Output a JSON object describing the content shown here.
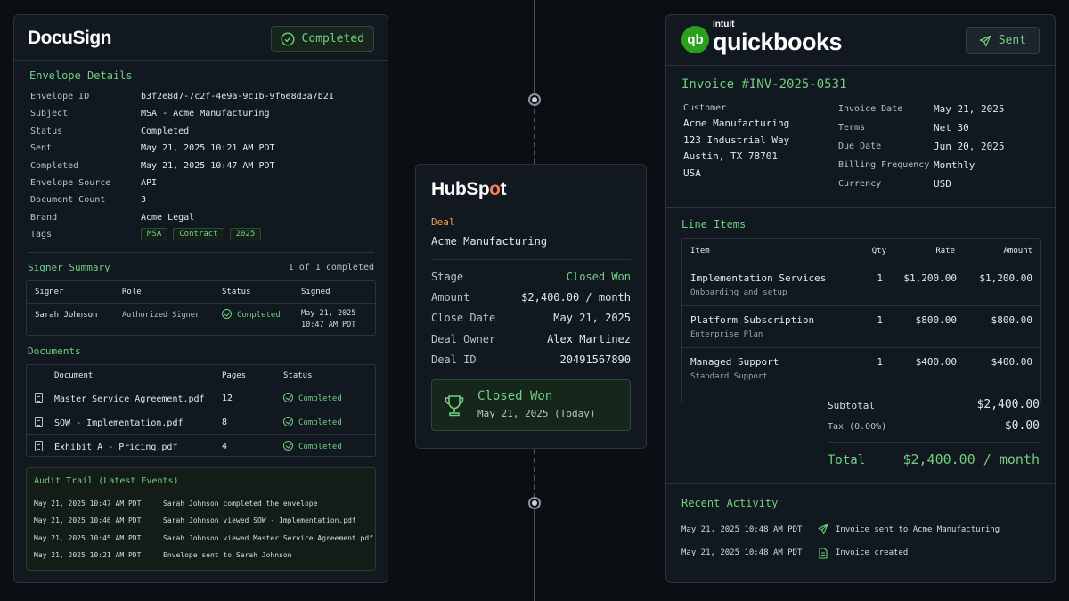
{
  "docusign": {
    "logo": "DocuSign",
    "badge": "Completed",
    "envelope_title": "Envelope Details",
    "details": [
      {
        "k": "Envelope ID",
        "v": "b3f2e8d7-7c2f-4e9a-9c1b-9f6e8d3a7b21"
      },
      {
        "k": "Subject",
        "v": "MSA - Acme Manufacturing"
      },
      {
        "k": "Status",
        "v": "Completed"
      },
      {
        "k": "Sent",
        "v": "May 21, 2025 10:21 AM PDT"
      },
      {
        "k": "Completed",
        "v": "May 21, 2025 10:47 AM PDT"
      },
      {
        "k": "Envelope Source",
        "v": "API"
      },
      {
        "k": "Document Count",
        "v": "3"
      },
      {
        "k": "Brand",
        "v": "Acme Legal"
      }
    ],
    "tags_label": "Tags",
    "tags": [
      "MSA",
      "Contract",
      "2025"
    ],
    "signer_title": "Signer Summary",
    "signer_count": "1 of 1 completed",
    "signer_headers": [
      "Signer",
      "Role",
      "Status",
      "Signed"
    ],
    "signer": {
      "name": "Sarah Johnson",
      "role": "Authorized Signer",
      "status": "Completed",
      "signed_1": "May 21, 2025",
      "signed_2": "10:47 AM PDT"
    },
    "documents_title": "Documents",
    "doc_headers": [
      "Document",
      "Pages",
      "Status"
    ],
    "documents": [
      {
        "name": "Master Service Agreement.pdf",
        "pages": "12",
        "status": "Completed"
      },
      {
        "name": "SOW - Implementation.pdf",
        "pages": "8",
        "status": "Completed"
      },
      {
        "name": "Exhibit A - Pricing.pdf",
        "pages": "4",
        "status": "Completed"
      }
    ],
    "audit_title": "Audit Trail (Latest Events)",
    "audit": [
      {
        "d": "May 21, 2025 10:47 AM PDT",
        "e": "Sarah Johnson completed the envelope"
      },
      {
        "d": "May 21, 2025 10:46 AM PDT",
        "e": "Sarah Johnson viewed SOW - Implementation.pdf"
      },
      {
        "d": "May 21, 2025 10:45 AM PDT",
        "e": "Sarah Johnson viewed Master Service Agreement.pdf"
      },
      {
        "d": "May 21, 2025 10:21 AM PDT",
        "e": "Envelope sent to Sarah Johnson"
      }
    ]
  },
  "hubspot": {
    "logo_a": "HubSp",
    "logo_o": "o",
    "logo_b": "t",
    "deal_label": "Deal",
    "deal_name": "Acme Manufacturing",
    "rows": [
      {
        "k": "Stage",
        "v": "Closed Won"
      },
      {
        "k": "Amount",
        "v": "$2,400.00 / month"
      },
      {
        "k": "Close Date",
        "v": "May 21, 2025"
      },
      {
        "k": "Deal Owner",
        "v": "Alex Martinez"
      },
      {
        "k": "Deal ID",
        "v": "20491567890"
      }
    ],
    "win_title": "Closed Won",
    "win_date": "May 21, 2025 (Today)"
  },
  "quickbooks": {
    "logo_circle": "qb",
    "logo_intuit": "intuit",
    "logo_name": "quickbooks",
    "badge": "Sent",
    "invoice_title": "Invoice #INV-2025-0531",
    "customer_label": "Customer",
    "customer_lines": [
      "Acme Manufacturing",
      "123 Industrial Way",
      "Austin, TX 78701",
      "USA"
    ],
    "meta": [
      {
        "k": "Invoice Date",
        "v": "May 21, 2025"
      },
      {
        "k": "Terms",
        "v": "Net 30"
      },
      {
        "k": "Due Date",
        "v": "Jun 20, 2025"
      },
      {
        "k": "Billing Frequency",
        "v": "Monthly"
      },
      {
        "k": "Currency",
        "v": "USD"
      }
    ],
    "line_items_title": "Line Items",
    "li_headers": [
      "Item",
      "Qty",
      "Rate",
      "Amount"
    ],
    "line_items": [
      {
        "item": "Implementation Services",
        "desc": "Onboarding and setup",
        "qty": "1",
        "rate": "$1,200.00",
        "amount": "$1,200.00"
      },
      {
        "item": "Platform Subscription",
        "desc": "Enterprise Plan",
        "qty": "1",
        "rate": "$800.00",
        "amount": "$800.00"
      },
      {
        "item": "Managed Support",
        "desc": "Standard Support",
        "qty": "1",
        "rate": "$400.00",
        "amount": "$400.00"
      }
    ],
    "subtotal_label": "Subtotal",
    "subtotal": "$2,400.00",
    "tax_label": "Tax (0.00%)",
    "tax": "$0.00",
    "total_label": "Total",
    "total": "$2,400.00 / month",
    "activity_title": "Recent Activity",
    "activity": [
      {
        "d": "May 21, 2025 10:48 AM PDT",
        "e": "Invoice sent to Acme Manufacturing",
        "icon": "send-icon"
      },
      {
        "d": "May 21, 2025 10:48 AM PDT",
        "e": "Invoice created",
        "icon": "document-icon"
      }
    ]
  },
  "colors": {
    "accent_green": "#6fcf7f",
    "hubspot_orange": "#ff7a59",
    "qb_green": "#2ca01c",
    "deal_orange": "#f0a04b"
  }
}
